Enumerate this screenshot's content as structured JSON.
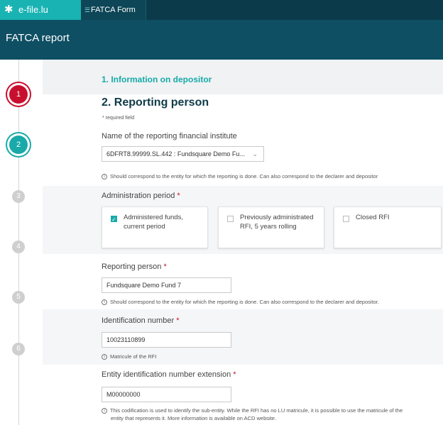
{
  "topbar": {
    "logo_text": "e-file.lu",
    "tab_label": "FATCA Form"
  },
  "header": {
    "title": "FATCA report"
  },
  "steps": [
    "1",
    "2",
    "3",
    "4",
    "5",
    "6"
  ],
  "section1": {
    "title": "1. Information on depositor"
  },
  "section2": {
    "title": "2. Reporting person",
    "required_note": "* required field",
    "rfi_name": {
      "label": "Name of the reporting financial institute",
      "value": "6DFRT8.99999.SL.442 : Fundsquare Demo Fu...",
      "help": "Should correspond to the entity for which the reporting is done. Can also correspond to the declarer and depositor"
    },
    "admin_period": {
      "label": "Administration period",
      "required_mark": "*",
      "options": [
        {
          "label": "Administered funds, current period",
          "checked": true
        },
        {
          "label": "Previously administrated RFI, 5 years rolling",
          "checked": false
        },
        {
          "label": "Closed RFI",
          "checked": false
        }
      ]
    },
    "reporting_person": {
      "label": "Reporting person",
      "required_mark": "*",
      "value": "Fundsquare Demo Fund 7",
      "help": "Should correspond to the entity for which the reporting is done. Can also correspond to the declarer and depositor."
    },
    "identification_number": {
      "label": "Identification number",
      "required_mark": "*",
      "value": "10023110899",
      "help": "Matricule of the RFI"
    },
    "entity_extension": {
      "label": "Entity identification number extension",
      "required_mark": "*",
      "value": "M00000000",
      "help_line1": "This codification is used to identify the sub-entity. While the RFI has no LU matricule, it is possible to use the matricule of the",
      "help_line2": "entity that represents it. More information is available on ACD website."
    }
  },
  "colors": {
    "topbar": "#0b3a4a",
    "header": "#0e4f63",
    "accent": "#19a9a9",
    "step_active": "#c8102e"
  }
}
